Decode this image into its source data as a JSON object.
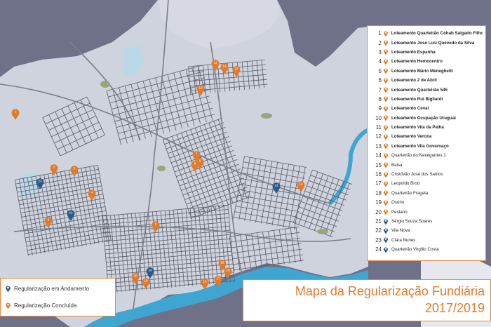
{
  "legend": {
    "items": [
      {
        "num": "1",
        "label": "Loteamento Quarteirão Cohab Salgado Filho",
        "status": "concluida",
        "bold": true
      },
      {
        "num": "2",
        "label": "Loteamento José Luiz Quevedo da Silva",
        "status": "concluida",
        "bold": true
      },
      {
        "num": "3",
        "label": "Loteamento Espanha",
        "status": "concluida",
        "bold": true
      },
      {
        "num": "4",
        "label": "Loteamento Hemocentro",
        "status": "concluida",
        "bold": true
      },
      {
        "num": "5",
        "label": "Loteamento Mário Meneghetti",
        "status": "concluida",
        "bold": true
      },
      {
        "num": "6",
        "label": "Loteamento 2 de Abril",
        "status": "concluida",
        "bold": true
      },
      {
        "num": "7",
        "label": "Loteamento Quarteirão 545",
        "status": "concluida",
        "bold": true
      },
      {
        "num": "8",
        "label": "Loteamento Rui Bigliardi",
        "status": "concluida",
        "bold": true
      },
      {
        "num": "9",
        "label": "Loteamento Ceval",
        "status": "concluida",
        "bold": true
      },
      {
        "num": "10",
        "label": "Loteamento Ocupação Uruguai",
        "status": "concluida",
        "bold": true
      },
      {
        "num": "11",
        "label": "Loteamento Vila da Palha",
        "status": "concluida",
        "bold": true
      },
      {
        "num": "12",
        "label": "Loteamento Verona",
        "status": "concluida",
        "bold": true
      },
      {
        "num": "13",
        "label": "Loteamento Vila Governaço",
        "status": "concluida",
        "bold": true
      },
      {
        "num": "14",
        "label": "Quarteirão do Navegantes 1",
        "status": "concluida",
        "bold": false
      },
      {
        "num": "15",
        "label": "Balsa",
        "status": "concluida",
        "bold": false
      },
      {
        "num": "16",
        "label": "Cristóvão José dos Santos",
        "status": "concluida",
        "bold": false
      },
      {
        "num": "17",
        "label": "Leopoldo Brod",
        "status": "concluida",
        "bold": false
      },
      {
        "num": "18",
        "label": "Quarteirão Fragata",
        "status": "concluida",
        "bold": false
      },
      {
        "num": "19",
        "label": "Osório",
        "status": "concluida",
        "bold": false
      },
      {
        "num": "20",
        "label": "Pestano",
        "status": "concluida",
        "bold": false
      },
      {
        "num": "21",
        "label": "Sérgio Souza Soares",
        "status": "andamento",
        "bold": false
      },
      {
        "num": "22",
        "label": "Vila Nova",
        "status": "andamento",
        "bold": false
      },
      {
        "num": "23",
        "label": "Clara Nunes",
        "status": "andamento",
        "bold": false
      },
      {
        "num": "24",
        "label": "Quarteirão Virgílio Costa",
        "status": "andamento",
        "bold": false
      }
    ]
  },
  "status_legend": {
    "andamento": "Regularização em Andamento",
    "concluida": "Regularização Concluída"
  },
  "title": {
    "main": "Mapa da Regularização Fundiária",
    "year": "2017/2019"
  },
  "colors": {
    "concluida": "#e07b2c",
    "andamento": "#2a5a8c",
    "water": "#6f7189",
    "land": "#cfd3dd",
    "street": "#5a5e6a",
    "river": "#3fa6d2"
  },
  "markers": [
    {
      "num": "1",
      "status": "concluida",
      "pos": [
        22,
        162
      ]
    },
    {
      "num": "2",
      "status": "concluida",
      "pos": [
        77,
        241
      ]
    },
    {
      "num": "3",
      "status": "concluida",
      "pos": [
        106,
        243
      ]
    },
    {
      "num": "4",
      "status": "concluida",
      "pos": [
        131,
        277
      ]
    },
    {
      "num": "5",
      "status": "concluida",
      "pos": [
        69,
        316
      ]
    },
    {
      "num": "6",
      "status": "concluida",
      "pos": [
        222,
        322
      ]
    },
    {
      "num": "7",
      "status": "concluida",
      "pos": [
        280,
        222
      ]
    },
    {
      "num": "8",
      "status": "concluida",
      "pos": [
        285,
        232
      ]
    },
    {
      "num": "9",
      "status": "concluida",
      "pos": [
        278,
        236
      ]
    },
    {
      "num": "10",
      "status": "concluida",
      "pos": [
        286,
        128
      ]
    },
    {
      "num": "11",
      "status": "concluida",
      "pos": [
        307,
        92
      ]
    },
    {
      "num": "12",
      "status": "concluida",
      "pos": [
        320,
        97
      ]
    },
    {
      "num": "13",
      "status": "concluida",
      "pos": [
        337,
        101
      ]
    },
    {
      "num": "14",
      "status": "concluida",
      "pos": [
        429,
        265
      ]
    },
    {
      "num": "15",
      "status": "concluida",
      "pos": [
        317,
        377
      ]
    },
    {
      "num": "16",
      "status": "concluida",
      "pos": [
        325,
        388
      ]
    },
    {
      "num": "17",
      "status": "concluida",
      "pos": [
        311,
        400
      ]
    },
    {
      "num": "18",
      "status": "concluida",
      "pos": [
        292,
        404
      ]
    },
    {
      "num": "19",
      "status": "concluida",
      "pos": [
        208,
        403
      ]
    },
    {
      "num": "20",
      "status": "concluida",
      "pos": [
        193,
        396
      ]
    },
    {
      "num": "21",
      "status": "andamento",
      "pos": [
        101,
        306
      ]
    },
    {
      "num": "22",
      "status": "andamento",
      "pos": [
        394,
        267
      ]
    },
    {
      "num": "23",
      "status": "andamento",
      "pos": [
        57,
        261
      ]
    },
    {
      "num": "24",
      "status": "andamento",
      "pos": [
        214,
        388
      ]
    }
  ]
}
